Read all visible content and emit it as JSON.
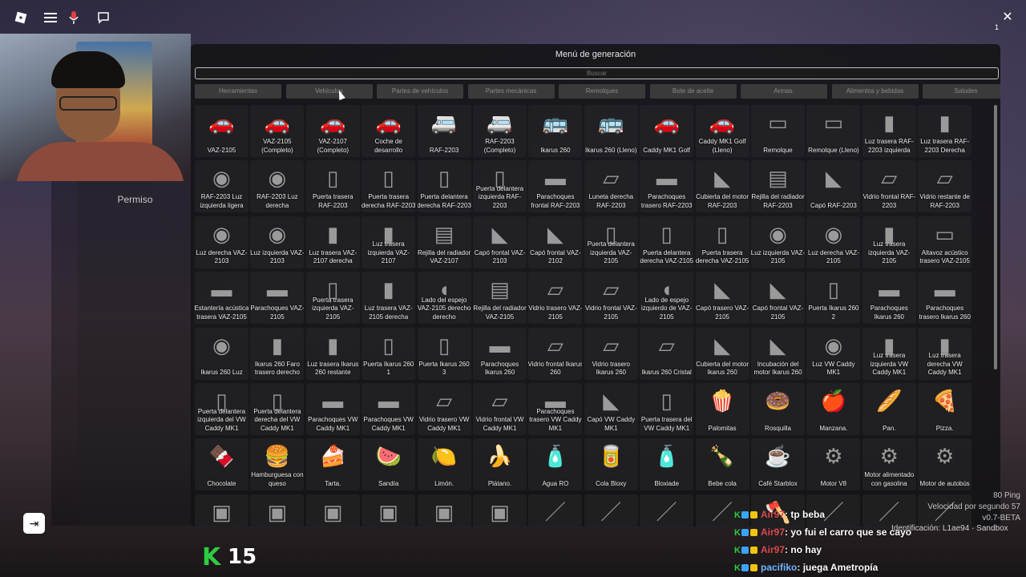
{
  "topbar": {
    "roblox_icon": "roblox-logo-icon",
    "menu_icon": "hamburger-icon",
    "mic_icon": "microphone-icon",
    "chat_icon": "chat-icon",
    "close_icon": "close-icon",
    "close_count": "1"
  },
  "left_panel": {
    "permission_label": "Permiso"
  },
  "menu": {
    "title": "Menú de generación",
    "search_placeholder": "Buscar",
    "tabs": [
      "Herramientas",
      "Vehículos",
      "Partes de vehículos",
      "Partes mecánicas",
      "Remolques",
      "Bote de aceite",
      "Armas.",
      "Alimentos y bebidas",
      "Saludes"
    ],
    "items": [
      [
        "VAZ-2105",
        "VAZ-2105 (Completo)",
        "VAZ-2107 (Completo)",
        "Coche de desarrollo",
        "RAF-2203",
        "RAF-2203 (Completo)",
        "Ikarus 260",
        "Ikarus 260 (Lleno)",
        "Caddy MK1 Golf",
        "Caddy MK1 Golf (Lleno)",
        "Remolque",
        "Remolque (Lleno)",
        "Luz trasera RAF-2203 izquierda",
        "Luz trasera RAF-2203 Derecha"
      ],
      [
        "RAF-2203 Luz izquierda ligera",
        "RAF-2203 Luz derecha",
        "Puerta trasera RAF-2203",
        "Puerta trasera derecha RAF-2203",
        "Puerta delantera derecha RAF-2203",
        "Puerta delantera izquierda RAF-2203",
        "Parachoques frontal RAF-2203",
        "Luneta derecha RAF-2203",
        "Parachoques trasero RAF-2203",
        "Cubierta del motor RAF-2203",
        "Rejilla del radiador RAF-2203",
        "Capó RAF-2203",
        "Vidrio frontal RAF-2203",
        "Vidrio restante de RAF-2203"
      ],
      [
        "Luz derecha VAZ-2103",
        "Luz izquierda VAZ-2103",
        "Luz trasera VAZ-2107 derecha",
        "Luz trasera izquierda VAZ-2107",
        "Rejilla del radiador VAZ-2107",
        "Capó frontal VAZ-2103",
        "Capó frontal VAZ-2102",
        "Puerta delantera izquierda VAZ-2105",
        "Puerta delantera derecha VAZ-2105",
        "Puerta trasera derecha VAZ-2105",
        "Luz izquierda VAZ-2105",
        "Luz derecha VAZ-2105",
        "Luz trasera izquierda VAZ-2105",
        "Altavoz acústico trasero VAZ-2105"
      ],
      [
        "Estantería acústica trasera VAZ-2105",
        "Parachoques VAZ-2105",
        "Puerta trasera izquierda VAZ-2105",
        "Luz trasera VAZ-2105 derecha",
        "Lado del espejo VAZ-2105 derecho derecho",
        "Rejilla del radiador VAZ-2105",
        "Vidrio trasero VAZ-2105",
        "Vidrio frontal VAZ-2105",
        "Lado de espejo izquierdo de VAZ-2105",
        "Capó trasero VAZ-2105",
        "Capó frontal VAZ-2105",
        "Puerta Ikarus 260 2",
        "Parachoques Ikarus 260",
        "Parachoques trasero Ikarus 260"
      ],
      [
        "Ikarus 260 Luz",
        "Ikarus 260 Faro trasero derecho",
        "Luz trasera Ikarus 260 restante",
        "Puerta Ikarus 260 1",
        "Puerta Ikarus 260 3",
        "Parachoques Ikarus 260",
        "Vidrio frontal Ikarus 260",
        "Vidrio trasero Ikarus 260",
        "Ikarus 260 Cristal",
        "Cubierta del motor Ikarus 260",
        "Incubación del motor Ikarus 260",
        "Luz VW Caddy MK1",
        "Luz trasera izquierda VW Caddy MK1",
        "Luz trasera derecha VW Caddy MK1"
      ],
      [
        "Puerta delantera izquierda del VW Caddy MK1",
        "Puerta delantera derecha del VW Caddy MK1",
        "Parachoques VW Caddy MK1",
        "Parachoques VW Caddy MK1",
        "Vidrio trasero VW Caddy MK1",
        "Vidrio frontal VW Caddy MK1",
        "Parachoques trasero VW Caddy MK1",
        "Capó VW Caddy MK1",
        "Puerta trasera del VW Caddy MK1",
        "Palomitas",
        "Rosquilla",
        "Manzana.",
        "Pan.",
        "Pizza."
      ],
      [
        "Chocolate",
        "Hamburguesa con queso",
        "Tarta.",
        "Sandía",
        "Limón.",
        "Plátano.",
        "Agua RO",
        "Cola Bloxy",
        "Bloxiade",
        "Bebe cola",
        "Café Starblox",
        "Motor V8",
        "Motor alimentado con gasolina",
        "Motor de autobús"
      ],
      [
        "",
        "",
        "",
        "",
        "",
        "",
        "",
        "",
        "",
        "",
        "",
        "",
        "",
        ""
      ]
    ],
    "thumbs": [
      [
        "car-icon",
        "car-icon",
        "car-icon",
        "car-icon",
        "van-icon",
        "van-icon",
        "bus-icon",
        "bus-icon",
        "car-icon",
        "car-icon",
        "trailer-icon",
        "trailer-icon",
        "taillight-icon",
        "taillight-icon"
      ],
      [
        "light-icon",
        "light-icon",
        "door-icon",
        "door-icon",
        "door-icon",
        "door-icon",
        "bumper-icon",
        "glass-icon",
        "bumper-icon",
        "hood-icon",
        "grille-icon",
        "hood-icon",
        "glass-icon",
        "glass-icon"
      ],
      [
        "light-icon",
        "light-icon",
        "taillight-icon",
        "taillight-icon",
        "grille-icon",
        "hood-icon",
        "hood-icon",
        "door-icon",
        "door-icon",
        "door-icon",
        "light-icon",
        "light-icon",
        "taillight-icon",
        "speaker-icon"
      ],
      [
        "shelf-icon",
        "bumper-icon",
        "door-icon",
        "taillight-icon",
        "mirror-icon",
        "grille-icon",
        "glass-icon",
        "glass-icon",
        "mirror-icon",
        "hood-icon",
        "hood-icon",
        "door-icon",
        "bumper-icon",
        "bumper-icon"
      ],
      [
        "light-icon",
        "taillight-icon",
        "taillight-icon",
        "door-icon",
        "door-icon",
        "bumper-icon",
        "glass-icon",
        "glass-icon",
        "glass-icon",
        "hood-icon",
        "hood-icon",
        "light-icon",
        "taillight-icon",
        "taillight-icon"
      ],
      [
        "door-icon",
        "door-icon",
        "bumper-icon",
        "bumper-icon",
        "glass-icon",
        "glass-icon",
        "bumper-icon",
        "hood-icon",
        "door-icon",
        "popcorn-icon",
        "donut-icon",
        "apple-icon",
        "bread-icon",
        "pizza-icon"
      ],
      [
        "chocolate-icon",
        "burger-icon",
        "cake-icon",
        "watermelon-icon",
        "lemon-icon",
        "banana-icon",
        "water-bottle-icon",
        "cola-can-icon",
        "bloxiade-bottle-icon",
        "cola-bottle-icon",
        "coffee-cup-icon",
        "engine-icon",
        "engine-icon",
        "engine-icon"
      ],
      [
        "box-icon",
        "box-icon",
        "box-icon",
        "box-icon",
        "box-icon",
        "box-icon",
        "tool-icon",
        "tool-icon",
        "tool-icon",
        "tool-icon",
        "axe-icon",
        "tool-icon",
        "tool-icon",
        "tool-icon"
      ]
    ]
  },
  "stats": {
    "ping": "80 Ping",
    "fps": "Velocidad por segundo 57",
    "version": "v0.7-BETA",
    "ident": "Identificación: L1ae94 · Sandbox"
  },
  "chat": [
    {
      "name": "Air97",
      "msg": "tp beba",
      "name_color": "#d94a4a"
    },
    {
      "name": "Air97",
      "msg": "yo fui el carro que se cayo",
      "name_color": "#d94a4a"
    },
    {
      "name": "Air97",
      "msg": "no hay",
      "name_color": "#d94a4a"
    },
    {
      "name": "pacifiko",
      "msg": "juega Ametropía",
      "name_color": "#6fb3ff"
    }
  ],
  "overlay": {
    "k_label": "K",
    "count": "15"
  }
}
